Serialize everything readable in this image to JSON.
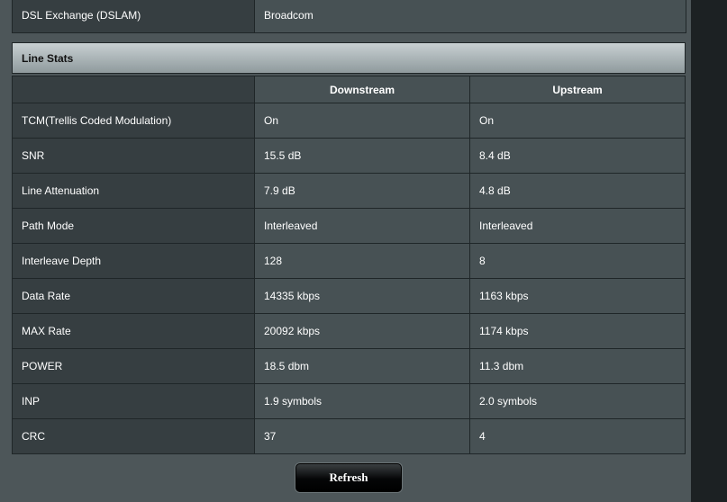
{
  "dslam": {
    "label": "DSL Exchange (DSLAM)",
    "value": "Broadcom"
  },
  "line_stats": {
    "title": "Line Stats",
    "columns": [
      "Downstream",
      "Upstream"
    ],
    "rows": [
      {
        "label": "TCM(Trellis Coded Modulation)",
        "down": "On",
        "up": "On"
      },
      {
        "label": "SNR",
        "down": "15.5 dB",
        "up": "8.4 dB"
      },
      {
        "label": "Line Attenuation",
        "down": "7.9 dB",
        "up": "4.8 dB"
      },
      {
        "label": "Path Mode",
        "down": "Interleaved",
        "up": "Interleaved"
      },
      {
        "label": "Interleave Depth",
        "down": "128",
        "up": "8"
      },
      {
        "label": "Data Rate",
        "down": "14335 kbps",
        "up": "1163 kbps"
      },
      {
        "label": "MAX Rate",
        "down": "20092 kbps",
        "up": "1174 kbps"
      },
      {
        "label": "POWER",
        "down": "18.5 dbm",
        "up": "11.3 dbm"
      },
      {
        "label": "INP",
        "down": "1.9 symbols",
        "up": "2.0 symbols"
      },
      {
        "label": "CRC",
        "down": "37",
        "up": "4"
      }
    ]
  },
  "actions": {
    "refresh_label": "Refresh"
  }
}
